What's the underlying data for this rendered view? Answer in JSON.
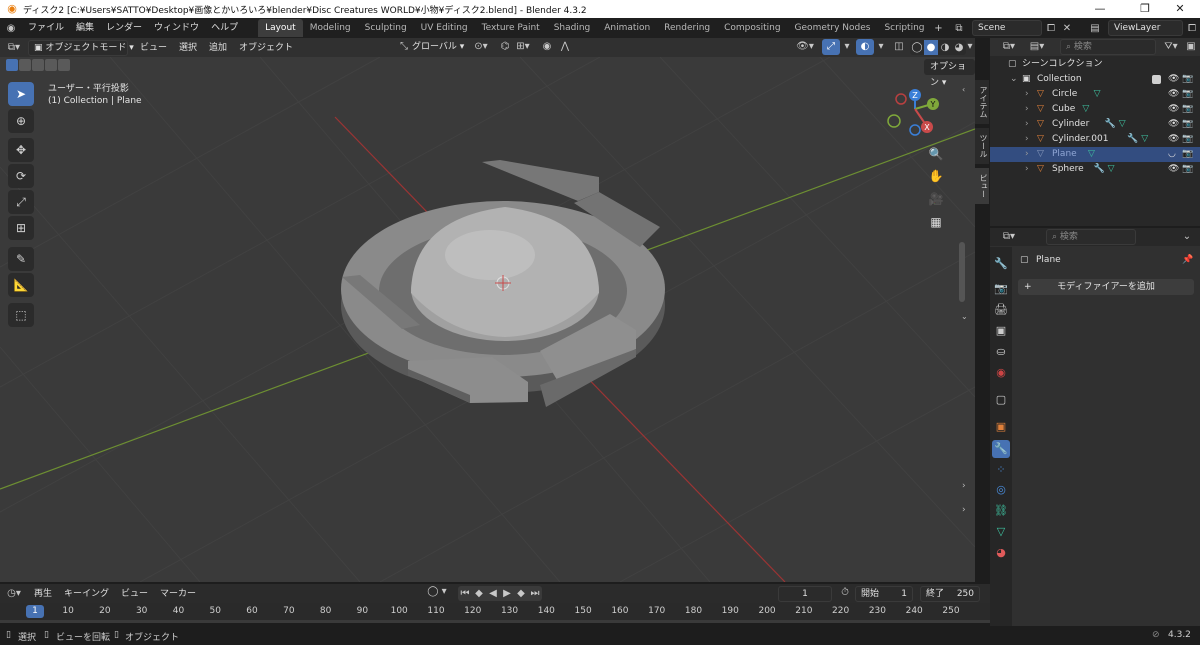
{
  "titlebar": {
    "title": "ディスク2 [C:¥Users¥SATTO¥Desktop¥画像とかいろいろ¥blender¥Disc Creatures WORLD¥小物¥ディスク2.blend] - Blender 4.3.2",
    "logo_icon": "blender-logo-icon",
    "minimize": "—",
    "maximize": "❐",
    "close": "✕"
  },
  "menu": [
    "ファイル",
    "編集",
    "レンダー",
    "ウィンドウ",
    "ヘルプ"
  ],
  "workspaces": [
    "Layout",
    "Modeling",
    "Sculpting",
    "UV Editing",
    "Texture Paint",
    "Shading",
    "Animation",
    "Rendering",
    "Compositing",
    "Geometry Nodes",
    "Scripting"
  ],
  "active_workspace": "Layout",
  "scene": {
    "name": "Scene",
    "view_layer": "ViewLayer"
  },
  "viewport_header": {
    "mode": "オブジェクトモード",
    "menus": [
      "ビュー",
      "選択",
      "追加",
      "オブジェクト"
    ],
    "transform_orientation": "グローバル",
    "options": "オプション"
  },
  "viewport": {
    "view_name": "ユーザー・平行投影",
    "collection_info": "(1) Collection | Plane",
    "gizmo": {
      "x": "X",
      "y": "Y",
      "z": "Z"
    },
    "side_tabs": [
      "アイテム",
      "ツール",
      "ビュー"
    ]
  },
  "tools": [
    "select-box-icon",
    "cursor-icon",
    "move-icon",
    "rotate-icon",
    "scale-icon",
    "transform-icon",
    "annotate-icon",
    "measure-icon",
    "add-cube-icon"
  ],
  "outliner": {
    "search_placeholder": "検索",
    "root": "シーンコレクション",
    "collection": "Collection",
    "items": [
      {
        "name": "Circle",
        "modifier": false,
        "mesh": true,
        "selected": false
      },
      {
        "name": "Cube",
        "modifier": false,
        "mesh": true,
        "selected": false
      },
      {
        "name": "Cylinder",
        "modifier": true,
        "mesh": true,
        "selected": false
      },
      {
        "name": "Cylinder.001",
        "modifier": true,
        "mesh": true,
        "selected": false
      },
      {
        "name": "Plane",
        "modifier": false,
        "mesh": true,
        "selected": true
      },
      {
        "name": "Sphere",
        "modifier": true,
        "mesh": true,
        "selected": false
      }
    ]
  },
  "properties": {
    "search_placeholder": "検索",
    "object_name": "Plane",
    "add_modifier": "モディファイアーを追加"
  },
  "timeline": {
    "menus": [
      "再生",
      "キーイング",
      "ビュー",
      "マーカー"
    ],
    "current_frame": "1",
    "start_label": "開始",
    "start": "1",
    "end_label": "終了",
    "end": "250",
    "ticks": [
      "1",
      "10",
      "20",
      "30",
      "40",
      "50",
      "60",
      "70",
      "80",
      "90",
      "100",
      "110",
      "120",
      "130",
      "140",
      "150",
      "160",
      "170",
      "180",
      "190",
      "200",
      "210",
      "220",
      "230",
      "240",
      "250"
    ]
  },
  "statusbar": {
    "select": "選択",
    "rotate_view": "ビューを回転",
    "object": "オブジェクト",
    "version": "4.3.2"
  },
  "colors": {
    "accent": "#4772b3",
    "x_axis": "#c94a4a",
    "y_axis": "#7fa83a",
    "z_axis": "#3a7fd8",
    "mesh_icon": "#3ec2a0",
    "object_icon": "#e0803a"
  }
}
